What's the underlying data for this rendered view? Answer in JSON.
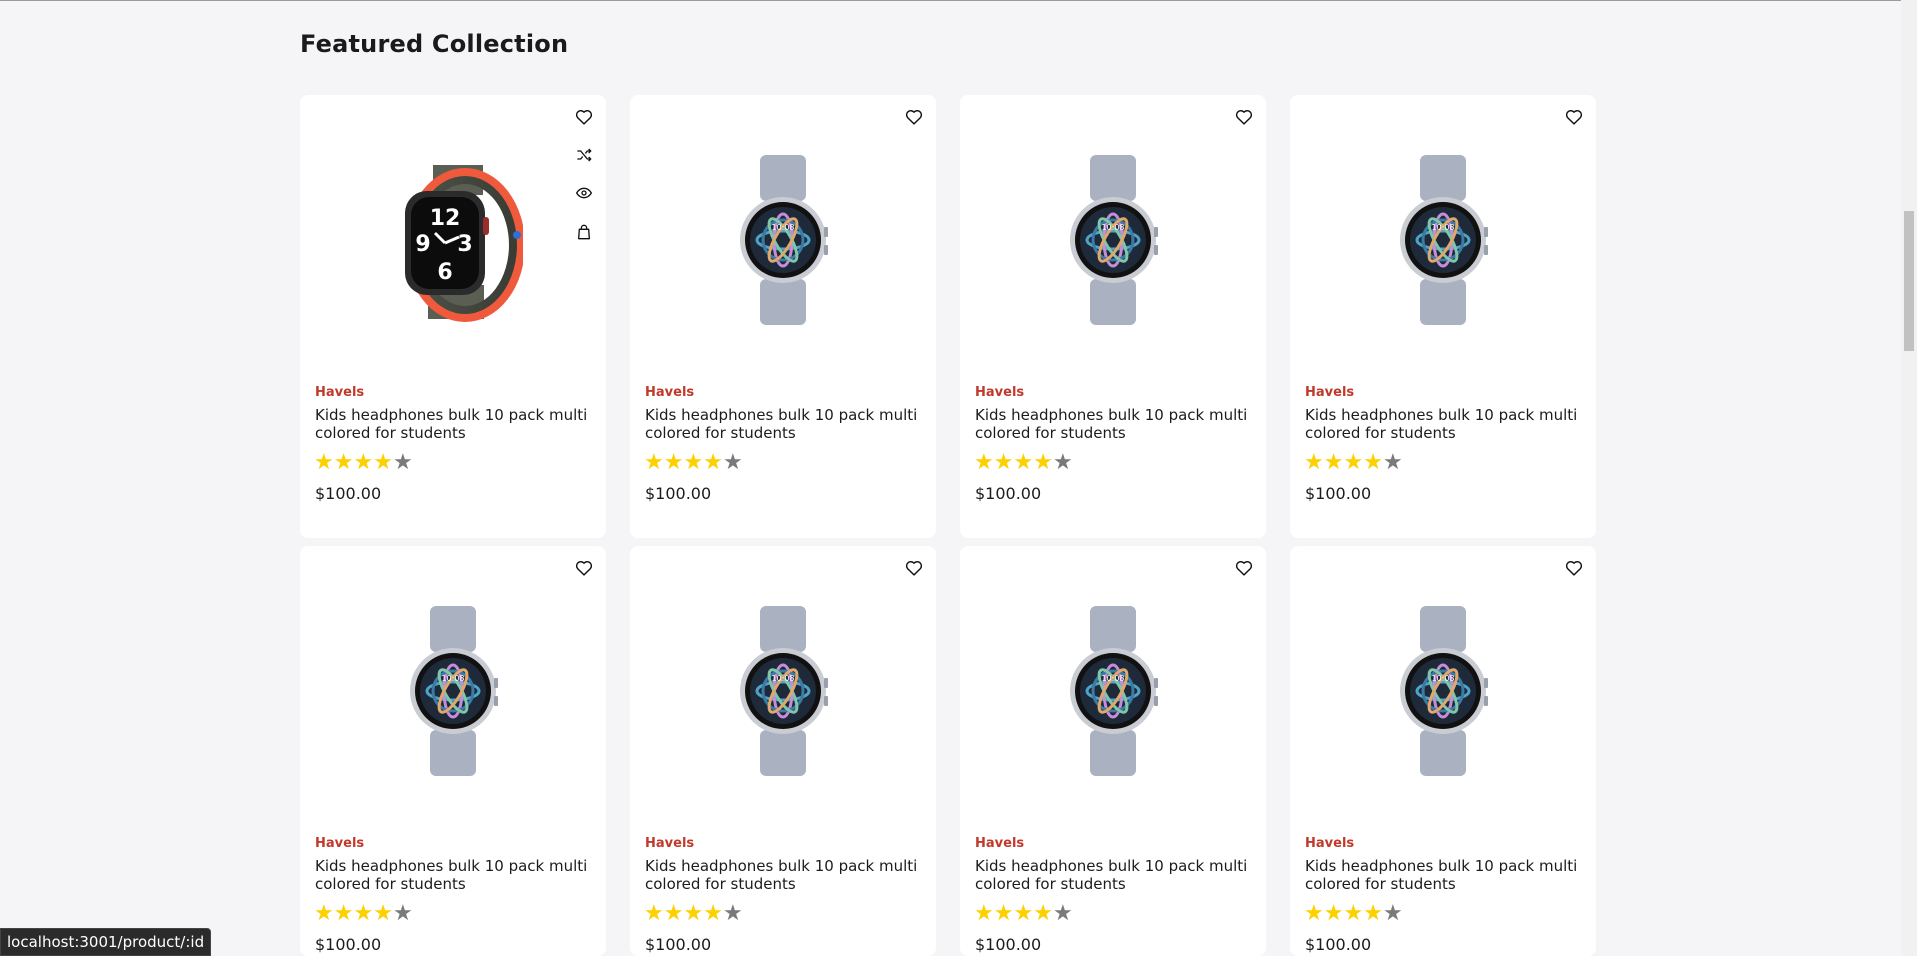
{
  "section": {
    "title": "Featured Collection"
  },
  "colors": {
    "brand_text": "#c0392b",
    "star_on": "#fdd000",
    "star_off": "#7a7a7a",
    "background": "#f5f5f7"
  },
  "icons": {
    "wishlist": "heart-icon",
    "compare": "shuffle-icon",
    "view": "eye-icon",
    "add_to_cart": "bag-icon"
  },
  "products": [
    {
      "brand": "Havels",
      "title": "Kids headphones bulk 10 pack multi colored for students",
      "price": "$100.00",
      "rating": 4,
      "max_rating": 5,
      "image": "apple-watch-sport-loop",
      "show_actions": true
    },
    {
      "brand": "Havels",
      "title": "Kids headphones bulk 10 pack multi colored for students",
      "price": "$100.00",
      "rating": 4,
      "max_rating": 5,
      "image": "galaxy-watch-silver",
      "show_actions": false
    },
    {
      "brand": "Havels",
      "title": "Kids headphones bulk 10 pack multi colored for students",
      "price": "$100.00",
      "rating": 4,
      "max_rating": 5,
      "image": "galaxy-watch-silver",
      "show_actions": false
    },
    {
      "brand": "Havels",
      "title": "Kids headphones bulk 10 pack multi colored for students",
      "price": "$100.00",
      "rating": 4,
      "max_rating": 5,
      "image": "galaxy-watch-silver",
      "show_actions": false
    },
    {
      "brand": "Havels",
      "title": "Kids headphones bulk 10 pack multi colored for students",
      "price": "$100.00",
      "rating": 4,
      "max_rating": 5,
      "image": "galaxy-watch-silver",
      "show_actions": false
    },
    {
      "brand": "Havels",
      "title": "Kids headphones bulk 10 pack multi colored for students",
      "price": "$100.00",
      "rating": 4,
      "max_rating": 5,
      "image": "galaxy-watch-silver",
      "show_actions": false
    },
    {
      "brand": "Havels",
      "title": "Kids headphones bulk 10 pack multi colored for students",
      "price": "$100.00",
      "rating": 4,
      "max_rating": 5,
      "image": "galaxy-watch-silver",
      "show_actions": false
    },
    {
      "brand": "Havels",
      "title": "Kids headphones bulk 10 pack multi colored for students",
      "price": "$100.00",
      "rating": 4,
      "max_rating": 5,
      "image": "galaxy-watch-silver",
      "show_actions": false
    }
  ],
  "status_bar": {
    "url": "localhost:3001/product/:id"
  }
}
